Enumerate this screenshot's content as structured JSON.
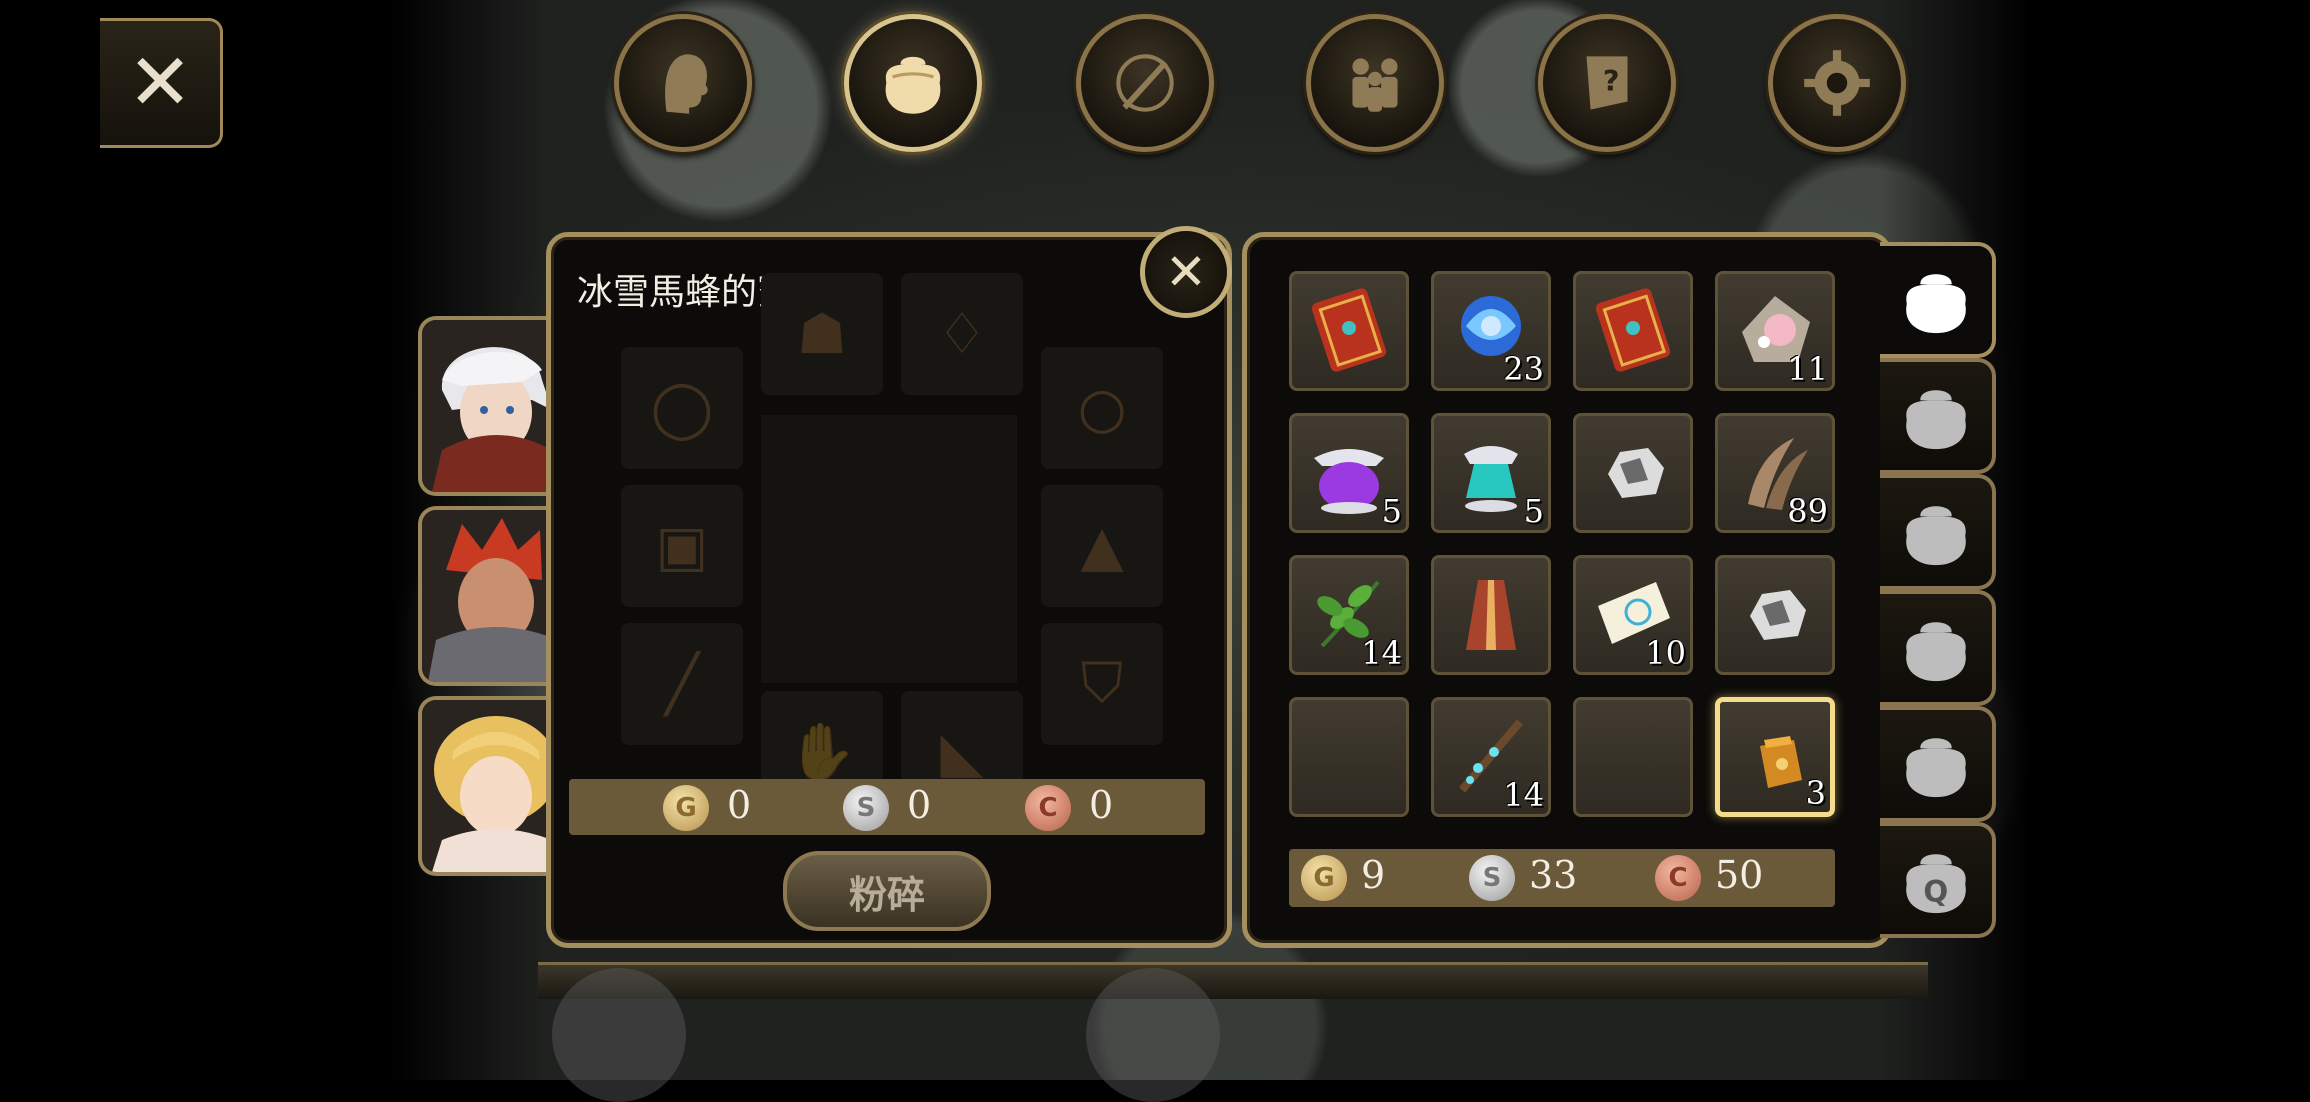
{
  "item_panel": {
    "title": "冰雪馬蜂的蜜汁",
    "coins": {
      "gold": "0",
      "silver": "0",
      "copper": "0"
    },
    "crush_button_label": "粉碎"
  },
  "inventory": {
    "slots": [
      {
        "icon": "red-book-icon",
        "count": ""
      },
      {
        "icon": "blue-orb-icon",
        "count": "23"
      },
      {
        "icon": "red-book-icon",
        "count": ""
      },
      {
        "icon": "pink-crystal-icon",
        "count": "11"
      },
      {
        "icon": "purple-potion-icon",
        "count": "5"
      },
      {
        "icon": "teal-potion-icon",
        "count": "5"
      },
      {
        "icon": "white-ore-icon",
        "count": ""
      },
      {
        "icon": "claw-icon",
        "count": "89"
      },
      {
        "icon": "green-leaf-icon",
        "count": "14"
      },
      {
        "icon": "red-robe-icon",
        "count": ""
      },
      {
        "icon": "scroll-icon",
        "count": "10"
      },
      {
        "icon": "white-ore-icon",
        "count": ""
      },
      {
        "icon": "",
        "count": ""
      },
      {
        "icon": "ice-branch-icon",
        "count": "14"
      },
      {
        "icon": "",
        "count": ""
      },
      {
        "icon": "honey-jar-icon",
        "count": "3"
      }
    ],
    "coins": {
      "gold": "9",
      "silver": "33",
      "copper": "50"
    }
  },
  "colors": {
    "frame": "#a58f5e",
    "coin_bar": "#6b5a3a",
    "selected": "#f4dc8c"
  }
}
